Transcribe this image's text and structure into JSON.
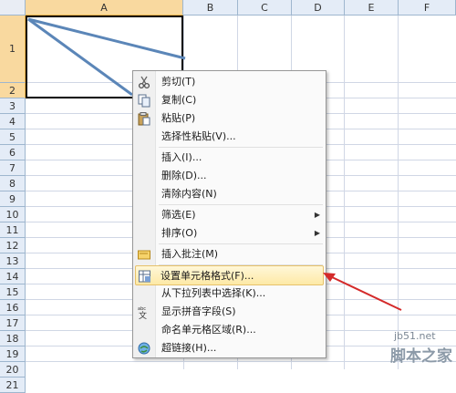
{
  "columns": [
    "A",
    "B",
    "C",
    "D",
    "E",
    "F"
  ],
  "rows": [
    "1",
    "2",
    "3",
    "4",
    "5",
    "6",
    "7",
    "8",
    "9",
    "10",
    "11",
    "12",
    "13",
    "14",
    "15",
    "16",
    "17",
    "18",
    "19",
    "20",
    "21"
  ],
  "context_menu": {
    "cut": "剪切(T)",
    "copy": "复制(C)",
    "paste": "粘贴(P)",
    "paste_special": "选择性粘贴(V)...",
    "insert": "插入(I)...",
    "delete": "删除(D)...",
    "clear_contents": "清除内容(N)",
    "filter": "筛选(E)",
    "sort": "排序(O)",
    "insert_comment": "插入批注(M)",
    "format_cells": "设置单元格格式(F)...",
    "pick_from_list": "从下拉列表中选择(K)...",
    "show_phonetic": "显示拼音字段(S)",
    "define_name": "命名单元格区域(R)...",
    "hyperlink": "超链接(H)..."
  },
  "watermark": {
    "site": "jb51.net",
    "brand": "脚本之家"
  },
  "colors": {
    "highlight": "#fde9a6",
    "arrow": "#d42a2a",
    "diagonal": "#5b86b8"
  }
}
